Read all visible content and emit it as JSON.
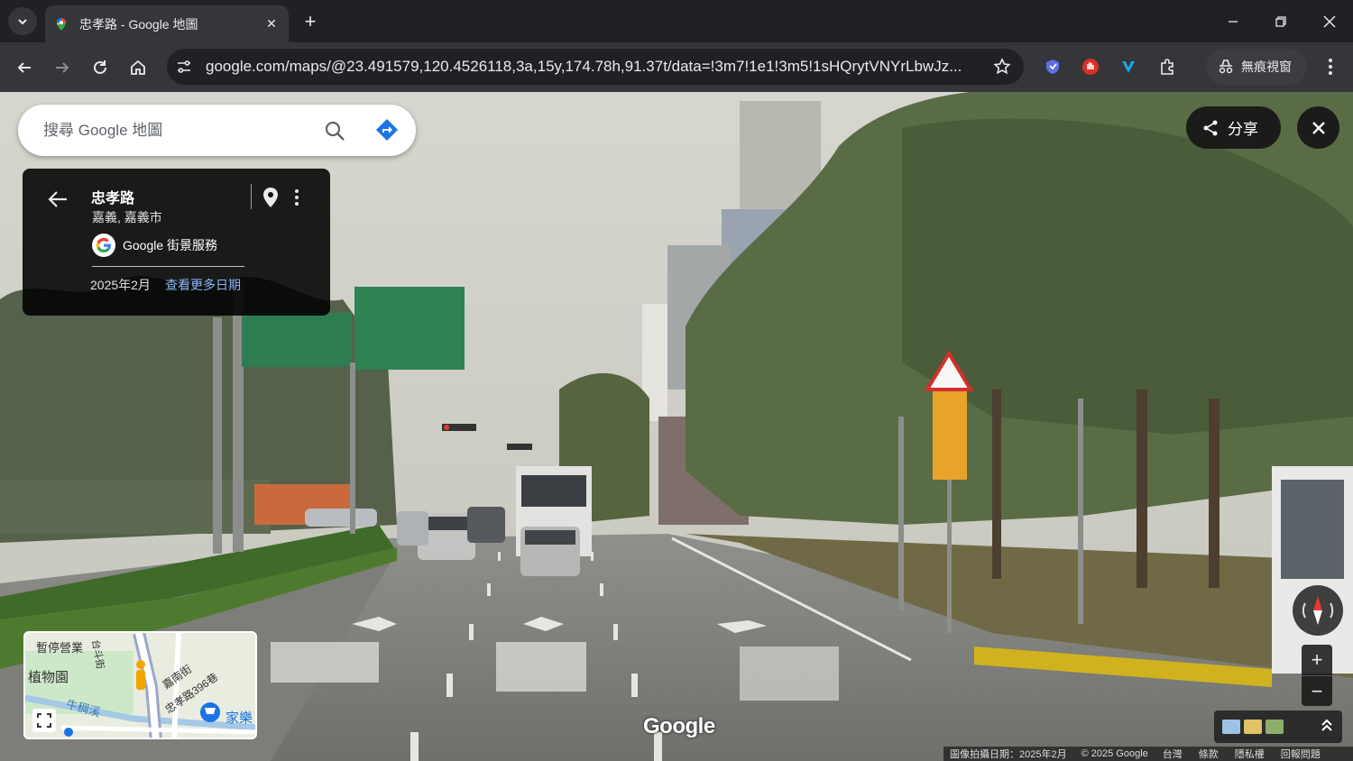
{
  "browser": {
    "tab_title": "忠孝路 - Google 地圖",
    "url": "google.com/maps/@23.491579,120.4526118,3a,15y,174.78h,91.37t/data=!3m7!1e1!3m5!1sHQrytVNYrLbwJz...",
    "incognito_label": "無痕視窗"
  },
  "search": {
    "placeholder": "搜尋 Google 地圖"
  },
  "place_card": {
    "title": "忠孝路",
    "subtitle": "嘉義, 嘉義市",
    "provider": "Google 街景服務",
    "capture_date": "2025年2月",
    "more_dates_link": "查看更多日期"
  },
  "controls": {
    "share_label": "分享"
  },
  "minimap": {
    "labels": [
      "暫停營業",
      "台斗街",
      "植物園",
      "嘉南街",
      "忠孝路396巷",
      "牛稠溪",
      "家樂"
    ]
  },
  "watermark": "Google",
  "footer": {
    "capture": "圖像拍攝日期：2025年2月",
    "copyright": "© 2025 Google",
    "region": "台灣",
    "terms": "條款",
    "privacy": "隱私權",
    "report": "回報問題"
  }
}
